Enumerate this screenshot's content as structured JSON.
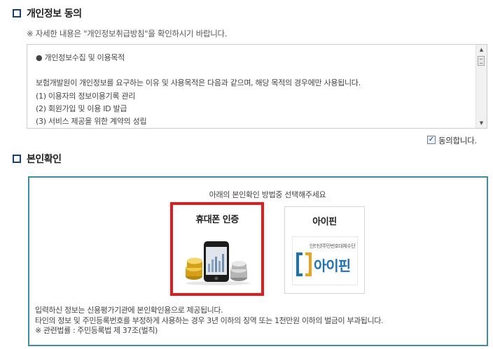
{
  "privacy_section": {
    "title": "개인정보 동의",
    "notice": "※ 자세한 내용은 \"개인정보취급방침\"을 확인하시기 바랍니다.",
    "terms": {
      "heading": "● 개인정보수집 및 이용목적",
      "intro": "보험개발원이 개인정보를 요구하는 이유 및 사용목적은 다음과 같으며, 해당 목적의 경우에만 사용됩니다.",
      "items": [
        "(1) 이용자의 정보이용기록 관리",
        "(2) 회원가입 및 이용 ID 발급",
        "(3) 서비스 제공을 위한 계약의 성립"
      ]
    },
    "agree_checked": true,
    "agree_label": "동의합니다."
  },
  "identity_section": {
    "title": "본인확인",
    "prompt": "아래의 본인확인 방법중 선택해주세요",
    "methods": [
      {
        "label": "휴대폰 인증",
        "selected": true,
        "icon": "phone-coins-icon"
      },
      {
        "label": "아이핀",
        "selected": false,
        "icon": "ipin-logo-icon",
        "logo_caption": "인터넷주민번호대체수단",
        "logo_text": "아이핀"
      }
    ],
    "footer_notes": [
      "입력하신 정보는 신용평가기관에 본인확인용으로 제공됩니다.",
      "타인의 정보 및 주민등록번호를 부정하게 사용하는 경우 3년 이하의 징역 또는 1천만원 이하의 벌금이 부과됩니다.",
      "※ 관련법률 : 주민등록법 제 37조(벌칙)"
    ]
  },
  "colors": {
    "section_icon": "#1c3f6e",
    "verify_border": "#3e8ea0",
    "selected_border": "#e01c1c",
    "ipin_blue": "#1e72b8"
  }
}
